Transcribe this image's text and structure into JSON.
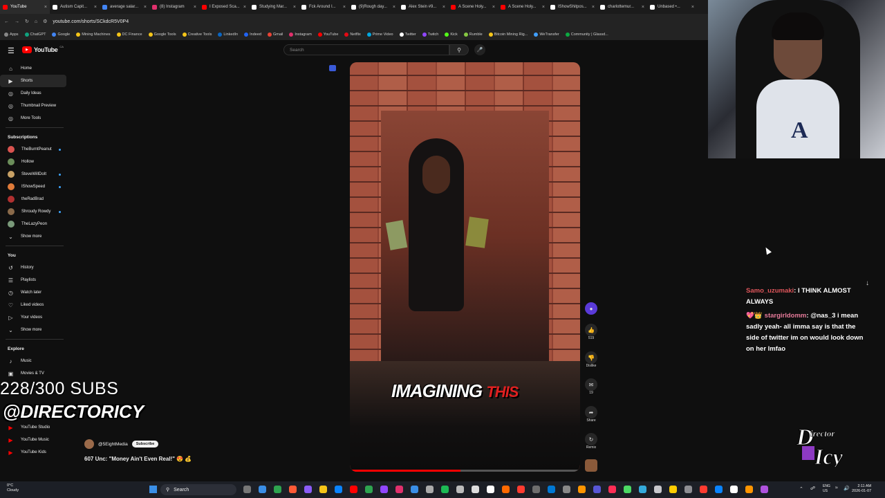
{
  "browser": {
    "tabs": [
      {
        "label": "YouTube",
        "color": "#ff0000",
        "active": true
      },
      {
        "label": "Autism Capit...",
        "color": "#ffffff"
      },
      {
        "label": "average salar...",
        "color": "#4285f4"
      },
      {
        "label": "(8) Instagram",
        "color": "#e1306c"
      },
      {
        "label": "I Exposed Sca...",
        "color": "#ff0000"
      },
      {
        "label": "Studying Mar...",
        "color": "#ffffff"
      },
      {
        "label": "Fck Around I...",
        "color": "#ffffff"
      },
      {
        "label": "(9)Rough day...",
        "color": "#ffffff"
      },
      {
        "label": "Alex Stein #9...",
        "color": "#ffffff"
      },
      {
        "label": "A Scene Holy...",
        "color": "#ff0000"
      },
      {
        "label": "A Scene Holy...",
        "color": "#ff0000"
      },
      {
        "label": "IShowShitpos...",
        "color": "#ffffff"
      },
      {
        "label": "charlottemur...",
        "color": "#ffffff"
      },
      {
        "label": "Unbased •...",
        "color": "#ffffff"
      }
    ],
    "url": "youtube.com/shorts/SCkdcR5V0P4",
    "bookmarks": [
      {
        "label": "Apps",
        "color": "#888888"
      },
      {
        "label": "ChatGPT",
        "color": "#10a37f"
      },
      {
        "label": "Google",
        "color": "#4285f4"
      },
      {
        "label": "Mining Machines",
        "color": "#f5c518"
      },
      {
        "label": "DC Finance",
        "color": "#f5c518"
      },
      {
        "label": "Google Tools",
        "color": "#f5c518"
      },
      {
        "label": "Creative Tools",
        "color": "#f5c518"
      },
      {
        "label": "LinkedIn",
        "color": "#0a66c2"
      },
      {
        "label": "Indeed",
        "color": "#2164f3"
      },
      {
        "label": "Gmail",
        "color": "#ea4335"
      },
      {
        "label": "Instagram",
        "color": "#e1306c"
      },
      {
        "label": "YouTube",
        "color": "#ff0000"
      },
      {
        "label": "Netflix",
        "color": "#e50914"
      },
      {
        "label": "Prime Video",
        "color": "#00a8e1"
      },
      {
        "label": "Twitter",
        "color": "#ffffff"
      },
      {
        "label": "Twitch",
        "color": "#9146ff"
      },
      {
        "label": "Kick",
        "color": "#53fc18"
      },
      {
        "label": "Rumble",
        "color": "#85c742"
      },
      {
        "label": "Bitcoin Mining Rig...",
        "color": "#f5c518"
      },
      {
        "label": "WeTransfer",
        "color": "#409fff"
      },
      {
        "label": "Community | Glassd...",
        "color": "#0caa41"
      }
    ]
  },
  "youtube": {
    "logo": "YouTube",
    "logo_sup": "CA",
    "search_placeholder": "Search",
    "sidebar": {
      "main": [
        {
          "label": "Home",
          "icon": "home-icon",
          "glyph": "⌂",
          "active": false
        },
        {
          "label": "Shorts",
          "icon": "shorts-icon",
          "glyph": "▶",
          "active": true
        },
        {
          "label": "Daily Ideas",
          "icon": "ideas-icon",
          "glyph": "◎",
          "active": false
        },
        {
          "label": "Thumbnail Preview",
          "icon": "thumbnail-icon",
          "glyph": "◎",
          "active": false
        },
        {
          "label": "More Tools",
          "icon": "tools-icon",
          "glyph": "◎",
          "active": false
        }
      ],
      "subscriptions_title": "Subscriptions",
      "subscriptions": [
        {
          "label": "TheBurntPeanut",
          "color": "#d9534f",
          "live": true
        },
        {
          "label": "Hollow",
          "color": "#6b8e5a",
          "live": false
        },
        {
          "label": "SteveWillDoIt",
          "color": "#c8a165",
          "live": true
        },
        {
          "label": "IShowSpeed",
          "color": "#e07b39",
          "live": true
        },
        {
          "label": "theRadBrad",
          "color": "#b03030",
          "live": false
        },
        {
          "label": "Shroudy Rowdy",
          "color": "#8a6a4a",
          "live": true
        },
        {
          "label": "TheLazyPeon",
          "color": "#7a9a7a",
          "live": false
        }
      ],
      "show_more": "Show more",
      "you_title": "You",
      "you": [
        {
          "label": "History",
          "icon": "history-icon",
          "glyph": "↺"
        },
        {
          "label": "Playlists",
          "icon": "playlists-icon",
          "glyph": "☰"
        },
        {
          "label": "Watch later",
          "icon": "watch-later-icon",
          "glyph": "◷"
        },
        {
          "label": "Liked videos",
          "icon": "like-icon",
          "glyph": "♡"
        },
        {
          "label": "Your videos",
          "icon": "your-videos-icon",
          "glyph": "▷"
        }
      ],
      "show_more_2": "Show more",
      "explore_title": "Explore",
      "explore": [
        {
          "label": "Music",
          "icon": "music-icon",
          "glyph": "♪"
        },
        {
          "label": "Movies & TV",
          "icon": "movies-icon",
          "glyph": "▣"
        }
      ],
      "youtube_apps": [
        {
          "label": "YouTube Premium",
          "color": "#ff0000"
        },
        {
          "label": "YouTube Studio",
          "color": "#ff0000"
        },
        {
          "label": "YouTube Music",
          "color": "#ff0000"
        },
        {
          "label": "YouTube Kids",
          "color": "#ff0000"
        }
      ]
    },
    "short": {
      "caption_white": "IMAGINING",
      "caption_red": "THIS",
      "progress": 0.48,
      "channel": "@5EightMedia",
      "subscribe": "Subscribe",
      "title": "607 Unc: \"Money Ain't Even Real!\" 😍 💰",
      "actions": {
        "likes": "519",
        "dislike": "Dislike",
        "comments": "19",
        "share": "Share",
        "remix": "Remix"
      }
    }
  },
  "overlay": {
    "subs_counter": "228/300 SUBS",
    "handle": "@DIRECTORICY",
    "brand_logo": "DIRECTOR ICY"
  },
  "chat": [
    {
      "user": "Samo_uzumaki",
      "message": ": I THINK ALMOST ALWAYS",
      "color": "#e0565b",
      "badges": ""
    },
    {
      "user": "stargirldomm",
      "message": ": @nas_3 i mean sadly yeah- all imma say is that the side of twitter im on would look down on her lmfao",
      "color": "#e87b9b",
      "badges": "💖👑"
    }
  ],
  "taskbar": {
    "weather_temp": "0°C",
    "weather_desc": "Cloudy",
    "search": "Search",
    "lang_1": "ENG",
    "lang_2": "US",
    "time": "2:11 AM",
    "date": "2026-01-07"
  }
}
